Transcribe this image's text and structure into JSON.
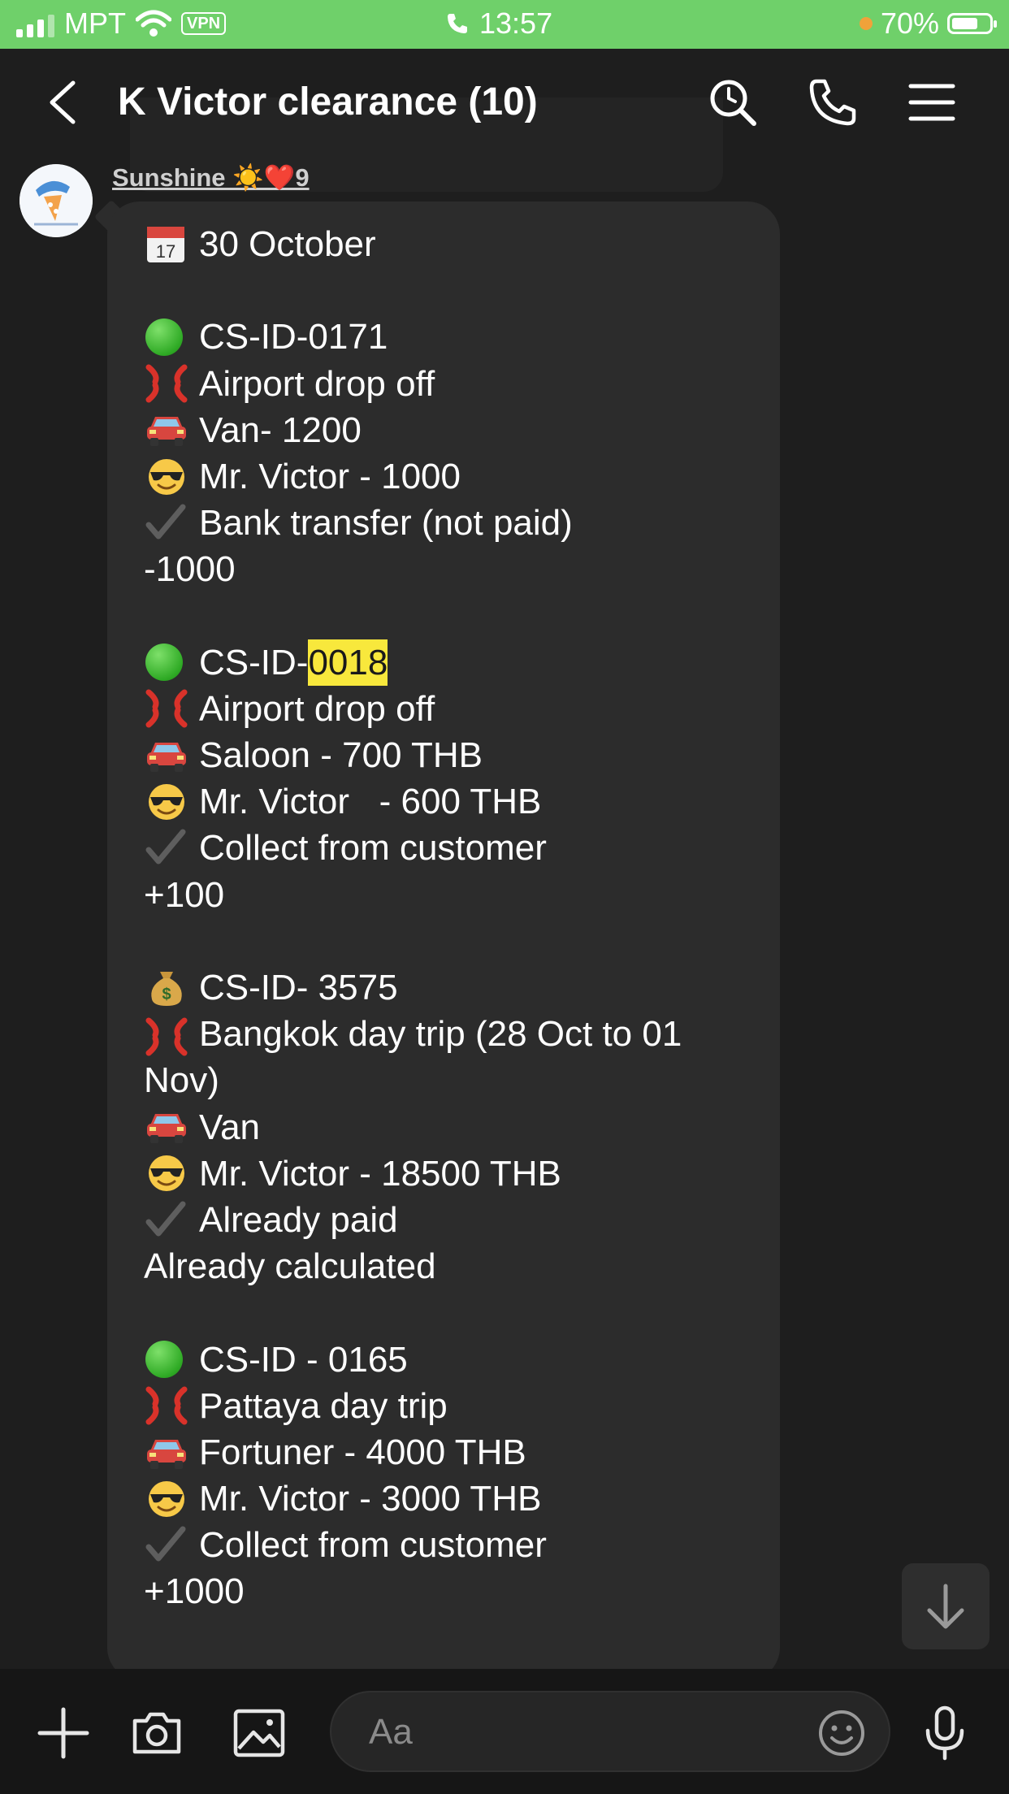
{
  "status_bar": {
    "carrier": "MPT",
    "vpn": "VPN",
    "time": "13:57",
    "battery": "70%",
    "battery_level": 0.7
  },
  "header": {
    "title": "K Victor clearance  (10)"
  },
  "message": {
    "sender": "Sunshine ☀️❤️9",
    "lines": [
      {
        "icon": "calendar-icon",
        "text": "30 October"
      },
      {
        "icon": "green-circle-icon",
        "text": "CS-ID-0171"
      },
      {
        "icon": "angry-symbol-icon",
        "text": "Airport drop off"
      },
      {
        "icon": "car-icon",
        "text": "Van- 1200"
      },
      {
        "icon": "sunglasses-face-icon",
        "text": "Mr. Victor - 1000"
      },
      {
        "icon": "checkmark-icon",
        "text": "Bank transfer (not paid)"
      },
      {
        "text": "-1000"
      },
      {
        "icon": "green-circle-icon",
        "prefix": "CS-ID-",
        "highlight": "0018"
      },
      {
        "icon": "angry-symbol-icon",
        "text": "Airport drop off"
      },
      {
        "icon": "car-icon",
        "text": "Saloon - 700 THB"
      },
      {
        "icon": "sunglasses-face-icon",
        "text": "Mr. Victor   - 600 THB"
      },
      {
        "icon": "checkmark-icon",
        "text": "Collect from customer"
      },
      {
        "text": "+100"
      },
      {
        "icon": "money-bag-icon",
        "text": "CS-ID- 3575"
      },
      {
        "icon": "angry-symbol-icon",
        "text": "Bangkok day trip (28 Oct to 01 Nov)"
      },
      {
        "icon": "car-icon",
        "text": "Van"
      },
      {
        "icon": "sunglasses-face-icon",
        "text": "Mr. Victor - 18500 THB"
      },
      {
        "icon": "checkmark-icon",
        "text": "Already paid"
      },
      {
        "text": "Already calculated"
      },
      {
        "icon": "green-circle-icon",
        "text": "CS-ID - 0165"
      },
      {
        "icon": "angry-symbol-icon",
        "text": "Pattaya day trip"
      },
      {
        "icon": "car-icon",
        "text": "Fortuner - 4000 THB"
      },
      {
        "icon": "sunglasses-face-icon",
        "text": "Mr. Victor - 3000 THB"
      },
      {
        "icon": "checkmark-icon",
        "text": "Collect from customer"
      },
      {
        "text": "+1000"
      }
    ]
  },
  "composer": {
    "placeholder": "Aa"
  },
  "colors": {
    "status_bar_green": "#6fd06a",
    "background": "#1e1e1e",
    "bubble": "#2c2c2c",
    "highlight": "#f8e83c"
  }
}
